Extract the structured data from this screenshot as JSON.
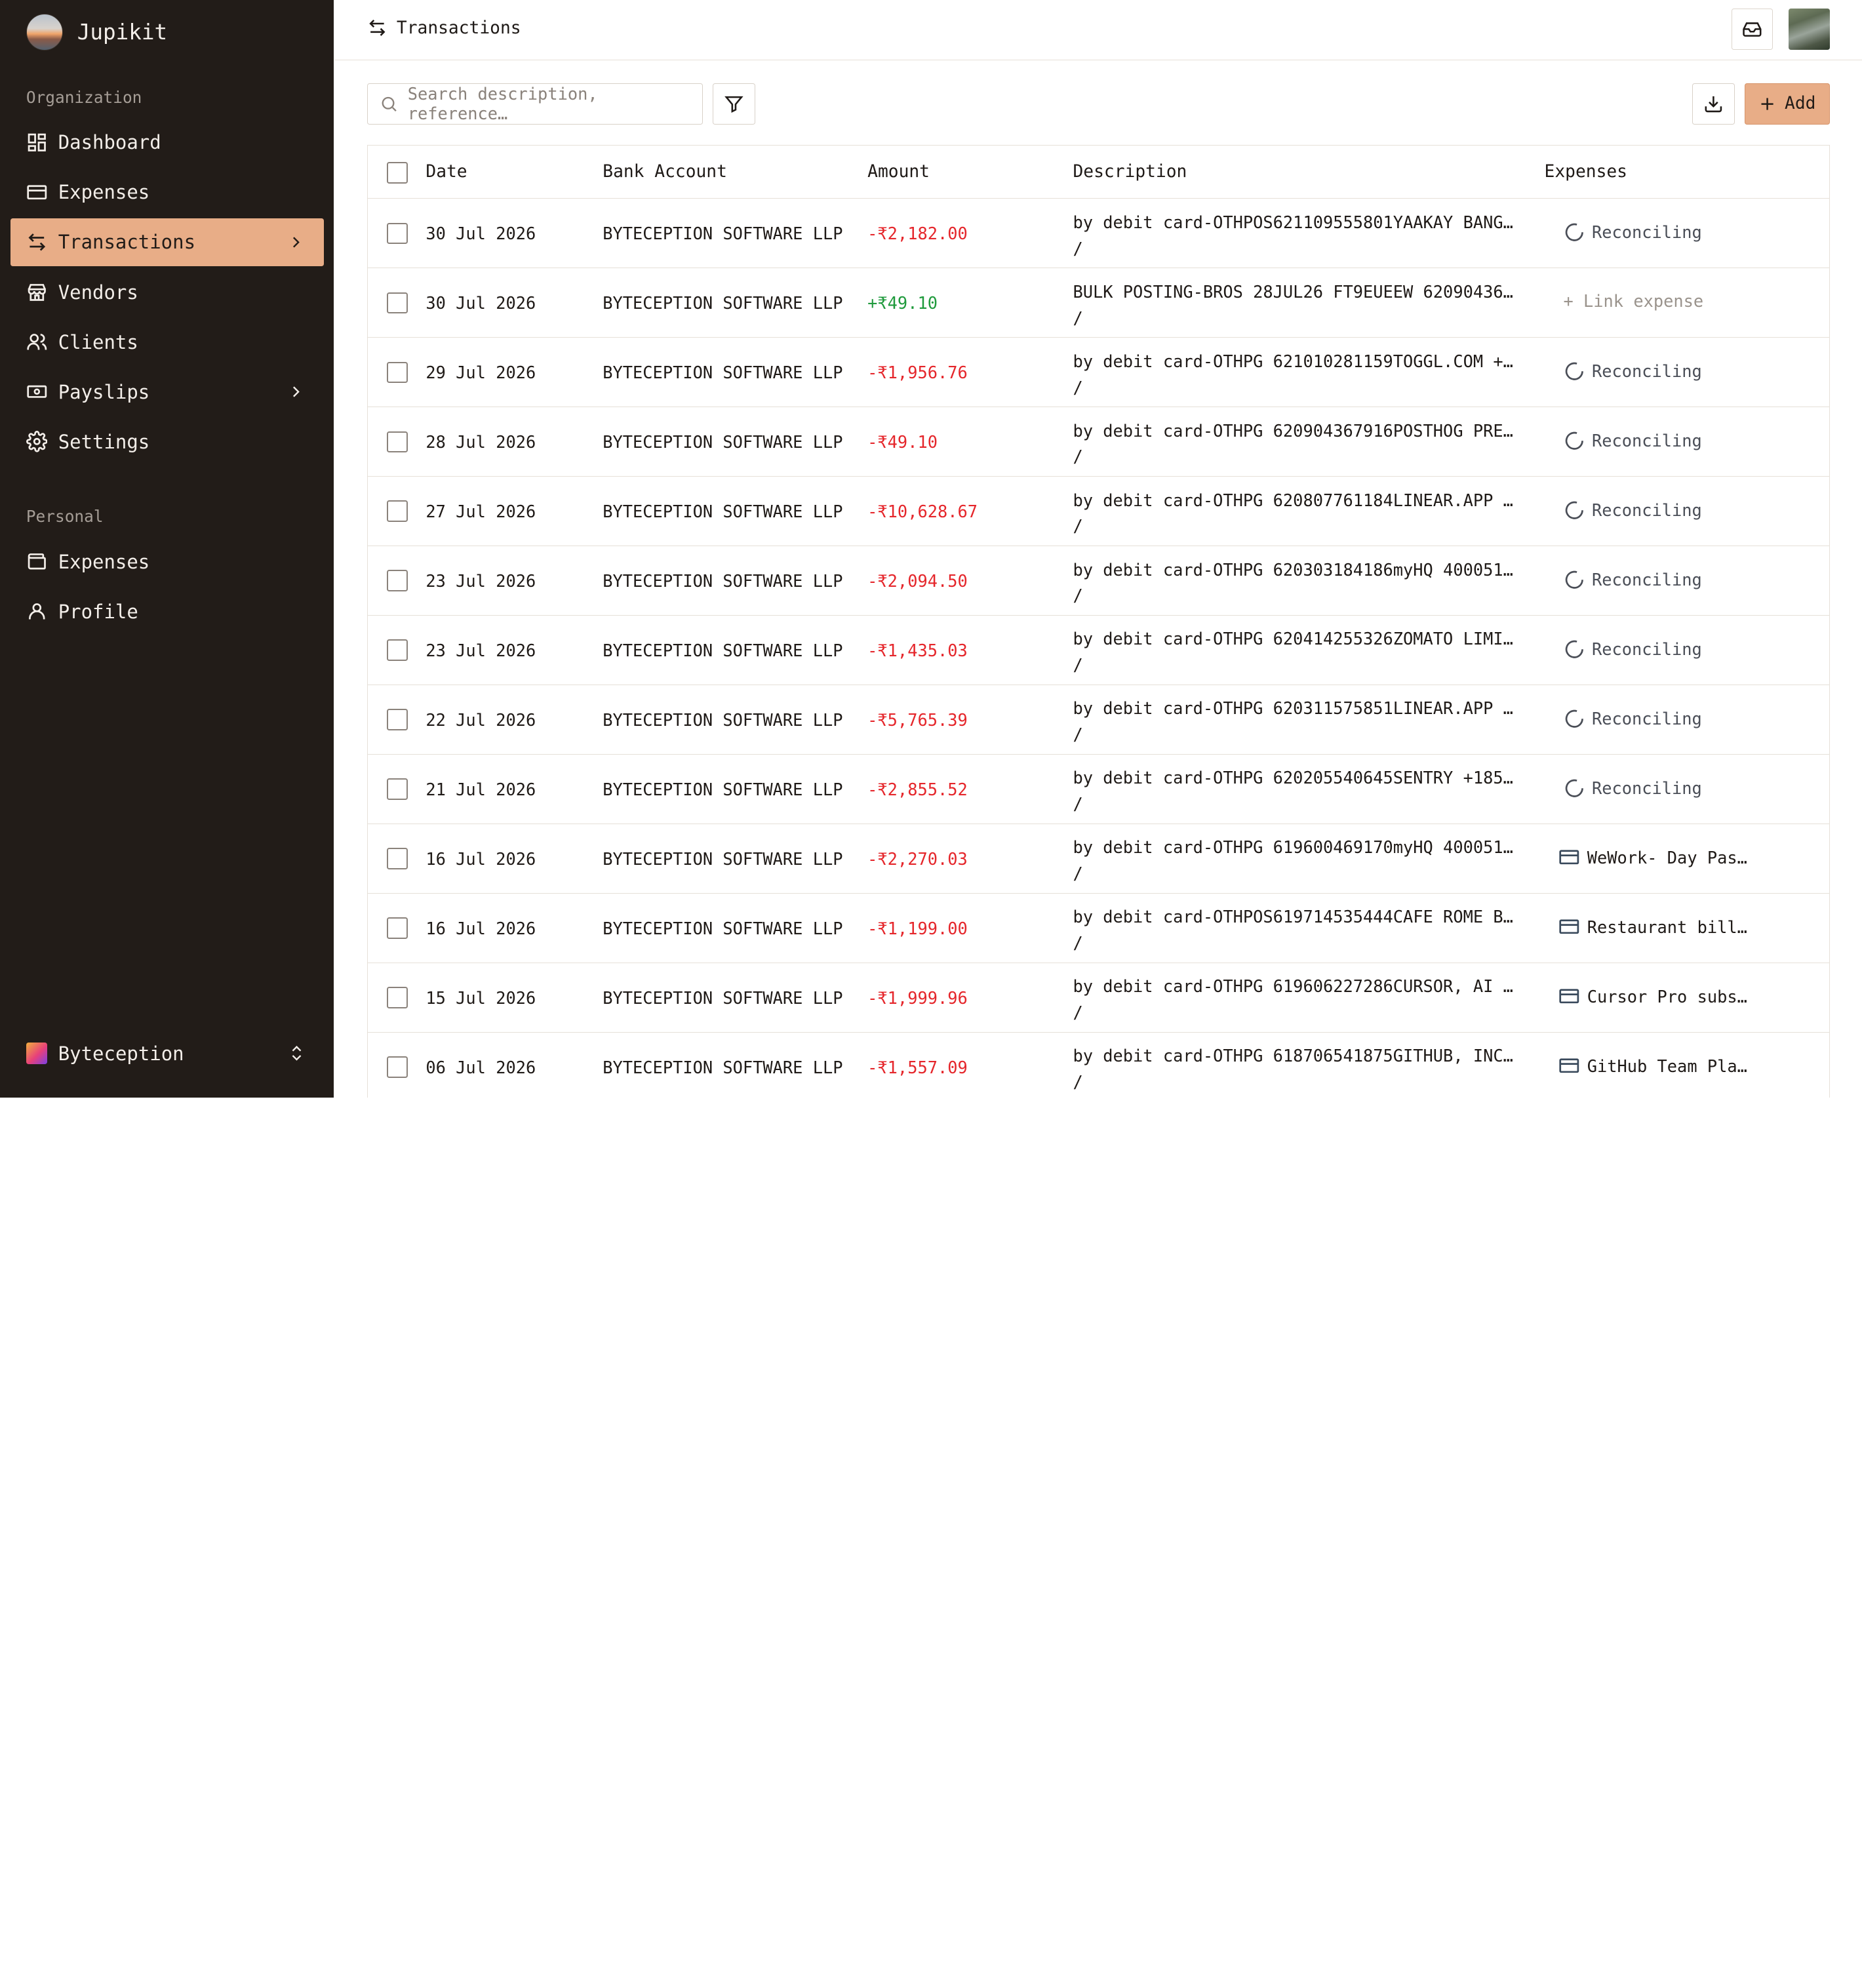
{
  "app": {
    "name": "Jupikit"
  },
  "sidebar": {
    "org_label": "Organization",
    "org_items": [
      {
        "label": "Dashboard",
        "icon": "dashboard-icon"
      },
      {
        "label": "Expenses",
        "icon": "credit-card-icon"
      },
      {
        "label": "Transactions",
        "icon": "arrows-left-right-icon",
        "active": true
      },
      {
        "label": "Vendors",
        "icon": "store-icon"
      },
      {
        "label": "Clients",
        "icon": "users-icon"
      },
      {
        "label": "Payslips",
        "icon": "banknote-icon"
      },
      {
        "label": "Settings",
        "icon": "gear-icon"
      }
    ],
    "personal_label": "Personal",
    "personal_items": [
      {
        "label": "Expenses",
        "icon": "wallet-icon"
      },
      {
        "label": "Profile",
        "icon": "user-icon"
      }
    ],
    "workspace": "Byteception"
  },
  "header": {
    "breadcrumb": "Transactions"
  },
  "toolbar": {
    "search_placeholder": "Search description, reference…",
    "add_label": "Add"
  },
  "table": {
    "columns": [
      "Date",
      "Bank Account",
      "Amount",
      "Description",
      "Expenses"
    ],
    "rows": [
      {
        "date": "30 Jul 2026",
        "bank": "BYTECEPTION SOFTWARE LLP",
        "amount": "-₹2,182.00",
        "sign": "neg",
        "desc1": "by debit card-OTHPOS621109555801YAAKAY BANGALO…",
        "desc2": "/",
        "expense_type": "reconciling",
        "expense": "Reconciling"
      },
      {
        "date": "30 Jul 2026",
        "bank": "BYTECEPTION SOFTWARE LLP",
        "amount": "+₹49.10",
        "sign": "pos",
        "desc1": "BULK POSTING-BROS 28JUL26 FT9EUEEW 62090436791…",
        "desc2": "/",
        "expense_type": "link",
        "expense": "+ Link expense"
      },
      {
        "date": "29 Jul 2026",
        "bank": "BYTECEPTION SOFTWARE LLP",
        "amount": "-₹1,956.76",
        "sign": "neg",
        "desc1": "by debit card-OTHPG 621010281159TOGGL.COM +372…",
        "desc2": "/",
        "expense_type": "reconciling",
        "expense": "Reconciling"
      },
      {
        "date": "28 Jul 2026",
        "bank": "BYTECEPTION SOFTWARE LLP",
        "amount": "-₹49.10",
        "sign": "neg",
        "desc1": "by debit card-OTHPG 620904367916POSTHOG PREAUT…",
        "desc2": "/",
        "expense_type": "reconciling",
        "expense": "Reconciling"
      },
      {
        "date": "27 Jul 2026",
        "bank": "BYTECEPTION SOFTWARE LLP",
        "amount": "-₹10,628.67",
        "sign": "neg",
        "desc1": "by debit card-OTHPG 620807761184LINEAR.APP +19…",
        "desc2": "/",
        "expense_type": "reconciling",
        "expense": "Reconciling"
      },
      {
        "date": "23 Jul 2026",
        "bank": "BYTECEPTION SOFTWARE LLP",
        "amount": "-₹2,094.50",
        "sign": "neg",
        "desc1": "by debit card-OTHPG 620303184186myHQ 400051--",
        "desc2": "/",
        "expense_type": "reconciling",
        "expense": "Reconciling"
      },
      {
        "date": "23 Jul 2026",
        "bank": "BYTECEPTION SOFTWARE LLP",
        "amount": "-₹1,435.03",
        "sign": "neg",
        "desc1": "by debit card-OTHPG 620414255326ZOMATO LIMITED…",
        "desc2": "/",
        "expense_type": "reconciling",
        "expense": "Reconciling"
      },
      {
        "date": "22 Jul 2026",
        "bank": "BYTECEPTION SOFTWARE LLP",
        "amount": "-₹5,765.39",
        "sign": "neg",
        "desc1": "by debit card-OTHPG 620311575851LINEAR.APP +19…",
        "desc2": "/",
        "expense_type": "reconciling",
        "expense": "Reconciling"
      },
      {
        "date": "21 Jul 2026",
        "bank": "BYTECEPTION SOFTWARE LLP",
        "amount": "-₹2,855.52",
        "sign": "neg",
        "desc1": "by debit card-OTHPG 620205540645SENTRY +185538…",
        "desc2": "/",
        "expense_type": "reconciling",
        "expense": "Reconciling"
      },
      {
        "date": "16 Jul 2026",
        "bank": "BYTECEPTION SOFTWARE LLP",
        "amount": "-₹2,270.03",
        "sign": "neg",
        "desc1": "by debit card-OTHPG 619600469170myHQ 400051--",
        "desc2": "/",
        "expense_type": "item",
        "expense": "WeWork- Day Pass…"
      },
      {
        "date": "16 Jul 2026",
        "bank": "BYTECEPTION SOFTWARE LLP",
        "amount": "-₹1,199.00",
        "sign": "neg",
        "desc1": "by debit card-OTHPOS619714535444CAFE ROME Bang…",
        "desc2": "/",
        "expense_type": "item",
        "expense": "Restaurant bill …"
      },
      {
        "date": "15 Jul 2026",
        "bank": "BYTECEPTION SOFTWARE LLP",
        "amount": "-₹1,999.96",
        "sign": "neg",
        "desc1": "by debit card-OTHPG 619606227286CURSOR, AI POW…",
        "desc2": "/",
        "expense_type": "item",
        "expense": "Cursor Pro subsc…"
      },
      {
        "date": "06 Jul 2026",
        "bank": "BYTECEPTION SOFTWARE LLP",
        "amount": "-₹1,557.09",
        "sign": "neg",
        "desc1": "by debit card-OTHPG 618706541875GITHUB, INC. +…",
        "desc2": "/",
        "expense_type": "item",
        "expense": "GitHub Team Plan…"
      }
    ]
  },
  "colors": {
    "sidebar_bg": "#221c18",
    "accent": "#e8ad87",
    "negative": "#e5262b",
    "positive": "#1f9a3c"
  }
}
